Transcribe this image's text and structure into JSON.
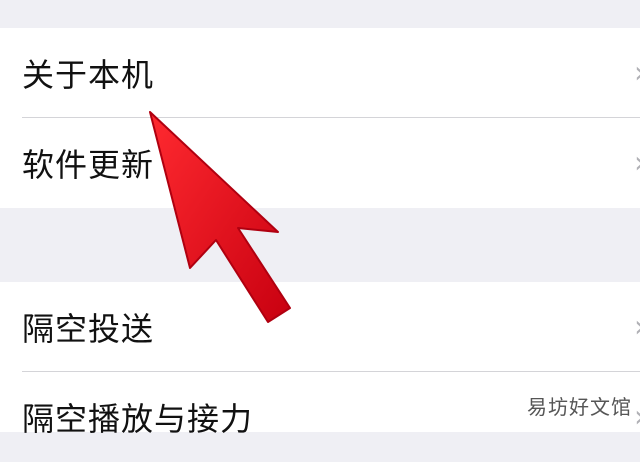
{
  "settings": {
    "group1": [
      {
        "label": "关于本机"
      },
      {
        "label": "软件更新"
      }
    ],
    "group2": [
      {
        "label": "隔空投送"
      },
      {
        "label": "隔空播放与接力"
      }
    ],
    "chevron_glyph": "›"
  },
  "annotation": {
    "arrow_color": "#e01020",
    "watermark": "易坊好文馆"
  }
}
